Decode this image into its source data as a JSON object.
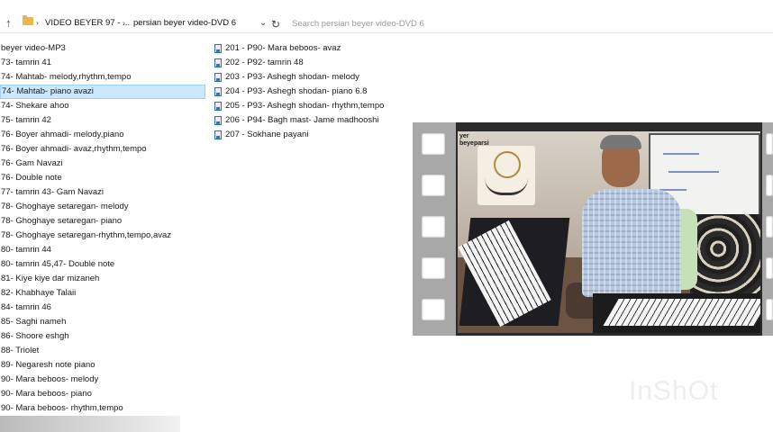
{
  "toolbar": {
    "breadcrumb": [
      "VIDEO BEYER 97 - ...",
      "persian beyer video-DVD 6"
    ],
    "search_placeholder": "Search persian beyer video-DVD 6"
  },
  "left_list": [
    "beyer video-MP3",
    "73- tamrin 41",
    "74- Mahtab- melody,rhythm,tempo",
    "74- Mahtab- piano avazi",
    "74- Shekare ahoo",
    "75- tamrin 42",
    "76- Boyer ahmadi- melody,piano",
    "76- Boyer ahmadi- avaz,rhythm,tempo",
    "76- Gam Navazi",
    "76- Double note",
    "77- tamrin 43- Gam Navazi",
    "78- Ghoghaye setaregan- melody",
    "78- Ghoghaye setaregan- piano",
    "78- Ghoghaye setaregan-rhythm,tempo,avaz",
    "80- tamrin 44",
    "80- tamrin 45,47- Double note",
    "81- Kiye kiye dar mizaneh",
    "82- Khabhaye Talaii",
    "84- tamrin 46",
    "85- Saghi nameh",
    "86- Shoore eshgh",
    "88- Triolet",
    "89- Negaresh note piano",
    "90- Mara beboos- melody",
    "90- Mara beboos- piano",
    "90- Mara beboos- rhythm,tempo"
  ],
  "selected_index": 3,
  "right_list": [
    "201 - P90- Mara beboos- avaz",
    "202 - P92- tamrin 48",
    "203 - P93- Ashegh shodan- melody",
    "204 - P93- Ashegh shodan- piano 6.8",
    "205 - P93- Ashegh shodan- rhythm,tempo",
    "206 - P94- Bagh mast- Jame madhooshi",
    "207 - Sokhane payani"
  ],
  "video": {
    "label_top": "yer",
    "label_sub": "beyeparsi"
  },
  "watermark": "InShOt"
}
